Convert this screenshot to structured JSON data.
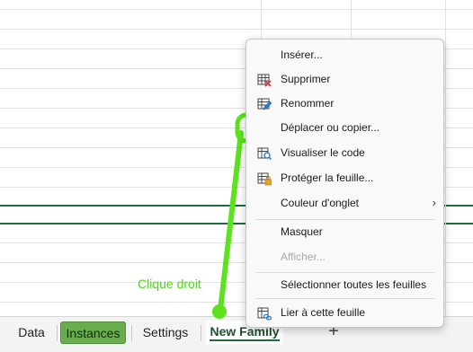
{
  "menu": {
    "items": [
      {
        "label": "Insérer...",
        "icon": "none",
        "disabled": false
      },
      {
        "label": "Supprimer",
        "icon": "delete-sheet-icon",
        "disabled": false
      },
      {
        "label": "Renommer",
        "icon": "rename-sheet-icon",
        "disabled": false
      },
      {
        "label": "Déplacer ou copier...",
        "icon": "none",
        "disabled": false
      },
      {
        "label": "Visualiser le code",
        "icon": "view-code-icon",
        "disabled": false
      },
      {
        "label": "Protéger la feuille...",
        "icon": "protect-sheet-icon",
        "disabled": false
      },
      {
        "label": "Couleur d'onglet",
        "icon": "none",
        "disabled": false,
        "submenu": true
      },
      {
        "label": "Masquer",
        "icon": "none",
        "disabled": false
      },
      {
        "label": "Afficher...",
        "icon": "none",
        "disabled": true
      },
      {
        "label": "Sélectionner toutes les feuilles",
        "icon": "none",
        "disabled": false
      },
      {
        "label": "Lier à cette feuille",
        "icon": "link-sheet-icon",
        "disabled": false
      }
    ],
    "submenu_glyph": "›"
  },
  "tabs": [
    {
      "label": "Data",
      "active": false,
      "colored": false
    },
    {
      "label": "Instances",
      "active": false,
      "colored": true,
      "color": "#6aad4f"
    },
    {
      "label": "Settings",
      "active": false,
      "colored": false
    },
    {
      "label": "New Family",
      "active": true,
      "colored": false
    }
  ],
  "add_sheet_label": "+",
  "annotation": {
    "label": "Clique droit",
    "color": "#4fd61a"
  },
  "colors": {
    "grid_line": "#e1e1e1",
    "dark_line": "#1f6b3a",
    "annotation": "#4fd61a"
  }
}
